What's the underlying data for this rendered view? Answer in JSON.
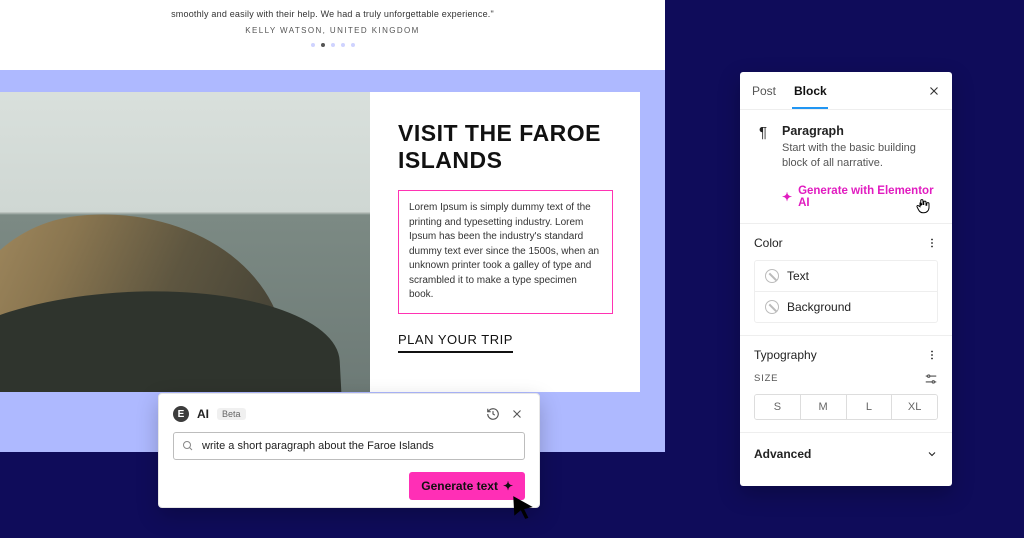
{
  "testimonial": {
    "quote": "smoothly and easily with their help. We had a truly unforgettable experience.\"",
    "author": "KELLY WATSON, UNITED KINGDOM"
  },
  "hero": {
    "heading": "VISIT THE FAROE ISLANDS",
    "lorem": "Lorem Ipsum is simply dummy text of the printing and typesetting industry. Lorem Ipsum has been the industry's standard dummy text ever since the 1500s, when an unknown printer took a galley of type and scrambled it to make a type specimen book.",
    "cta": "PLAN YOUR TRIP"
  },
  "ai": {
    "title": "AI",
    "badge": "Beta",
    "history_icon": "history-icon",
    "close_icon": "close-icon",
    "search_icon": "search-icon",
    "input_value": "write a short paragraph about the Faroe Islands",
    "generate_label": "Generate text"
  },
  "panel": {
    "tabs": {
      "post": "Post",
      "block": "Block"
    },
    "close_icon": "close-icon",
    "block": {
      "title": "Paragraph",
      "desc": "Start with the basic building block of all narrative.",
      "ai_link": "Generate with Elementor AI"
    },
    "color": {
      "heading": "Color",
      "rows": {
        "text": "Text",
        "background": "Background"
      }
    },
    "typo": {
      "heading": "Typography",
      "size_label": "SIZE",
      "sizes": {
        "s": "S",
        "m": "M",
        "l": "L",
        "xl": "XL"
      }
    },
    "advanced": "Advanced"
  }
}
